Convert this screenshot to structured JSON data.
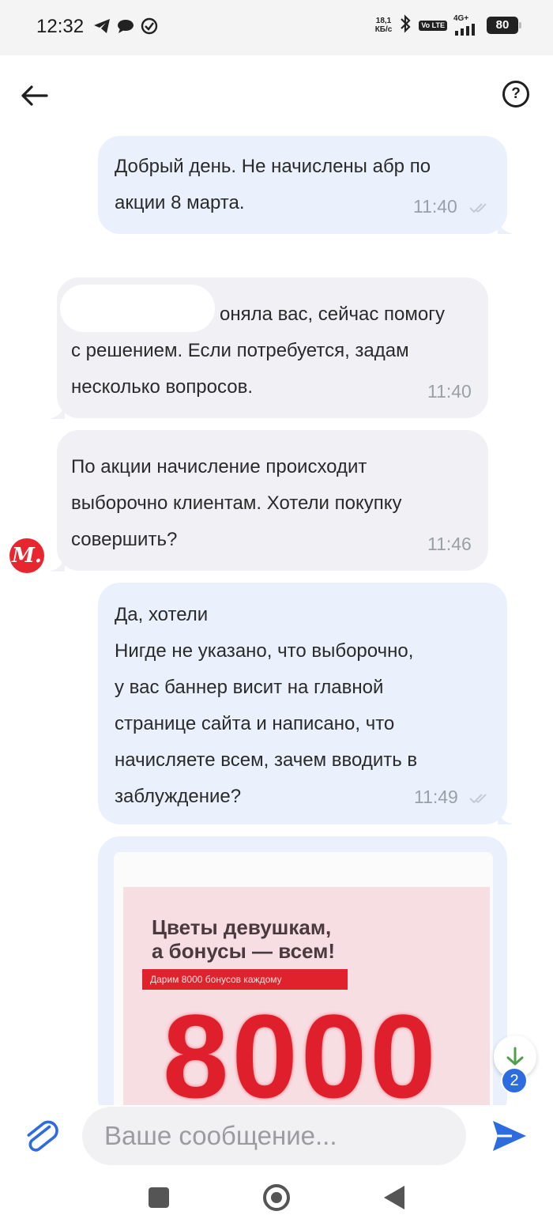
{
  "status_bar": {
    "time": "12:32",
    "speed_value": "18,1",
    "speed_unit": "КБ/с",
    "volte": "Vo LTE",
    "network": "4G+",
    "battery": "80"
  },
  "header": {
    "back_icon": "arrow-left-icon",
    "help_label": "?"
  },
  "messages": [
    {
      "direction": "outgoing",
      "lines": [
        "Добрый день. Не начислены абр по",
        "акции 8 марта."
      ],
      "time": "11:40",
      "read": true
    },
    {
      "direction": "incoming",
      "lines": [
        "оняла вас, сейчас помогу",
        "с решением. Если потребуется, задам",
        "несколько вопросов."
      ],
      "time": "11:40"
    },
    {
      "direction": "incoming",
      "lines": [
        "По акции начисление происходит",
        "выборочно клиентам.  Хотели покупку",
        "совершить?"
      ],
      "time": "11:46",
      "avatar_letter": "М."
    },
    {
      "direction": "outgoing",
      "lines": [
        "Да, хотели",
        "Нигде не указано, что выборочно,",
        "у вас баннер висит на главной",
        "странице сайта и написано, что",
        "начисляете всем, зачем вводить в",
        "заблуждение?"
      ],
      "time": "11:49",
      "read": true
    }
  ],
  "image_message": {
    "banner_title_line1": "Цветы девушкам,",
    "banner_title_line2": "а бонусы — всем!",
    "banner_strip": "Дарим 8000 бонусов каждому",
    "banner_number": "8000"
  },
  "scroll_down": {
    "icon": "arrow-down-icon",
    "unread_count": "2"
  },
  "composer": {
    "placeholder": "Ваше сообщение...",
    "attach_icon": "paperclip-icon",
    "send_icon": "send-icon"
  },
  "colors": {
    "outgoing_bubble": "#eaf1fd",
    "incoming_bubble": "#f1f0f5",
    "accent": "#2d6cdf",
    "brand_red": "#e8262f"
  }
}
